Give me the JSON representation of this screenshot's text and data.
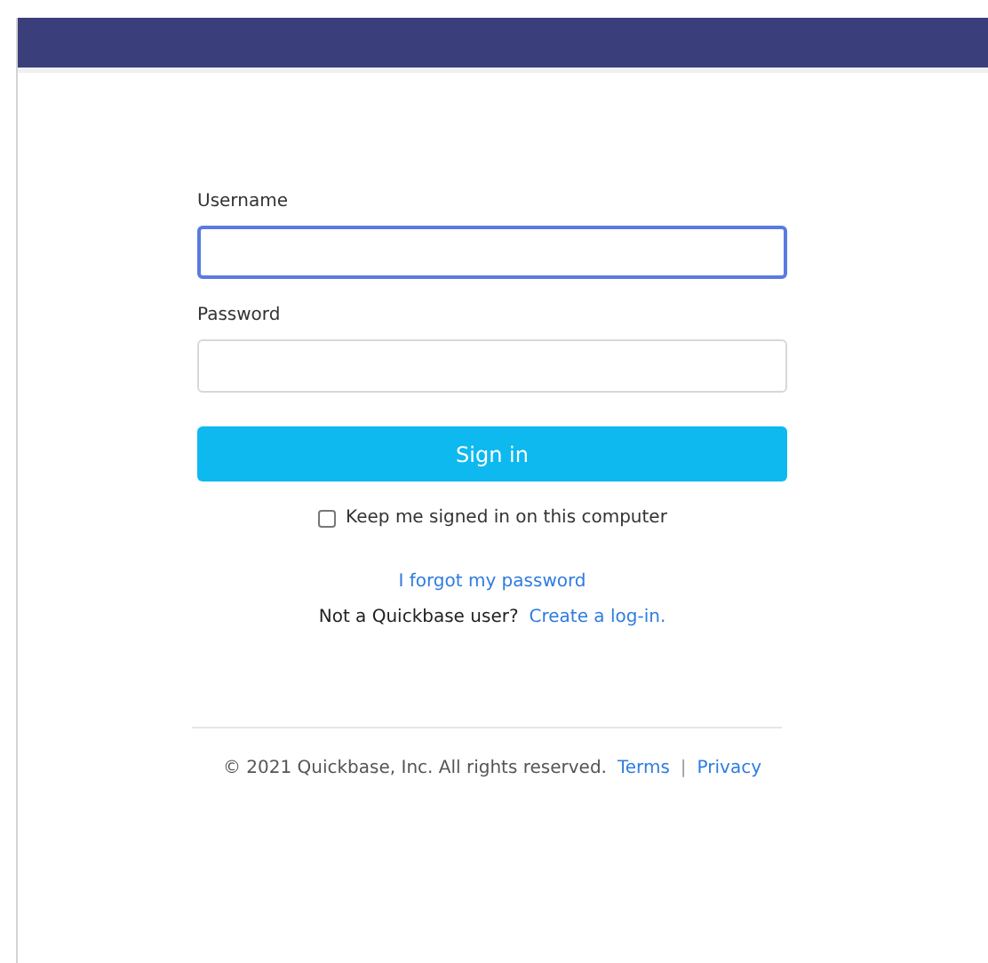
{
  "fields": [
    {
      "label": "Username",
      "focused": true
    },
    {
      "label": "Password",
      "focused": false
    }
  ],
  "sign_in_button": "Sign in",
  "keep_signed_in": {
    "label": "Keep me signed in on this computer",
    "checked": false
  },
  "forgot_link": "I forgot my password",
  "signup": {
    "text": "Not a Quickbase user?",
    "link": "Create a log-in."
  },
  "footer": {
    "copyright": "© 2021 Quickbase, Inc. All rights reserved.",
    "links": [
      "Terms",
      "Privacy"
    ],
    "separator": "|"
  }
}
